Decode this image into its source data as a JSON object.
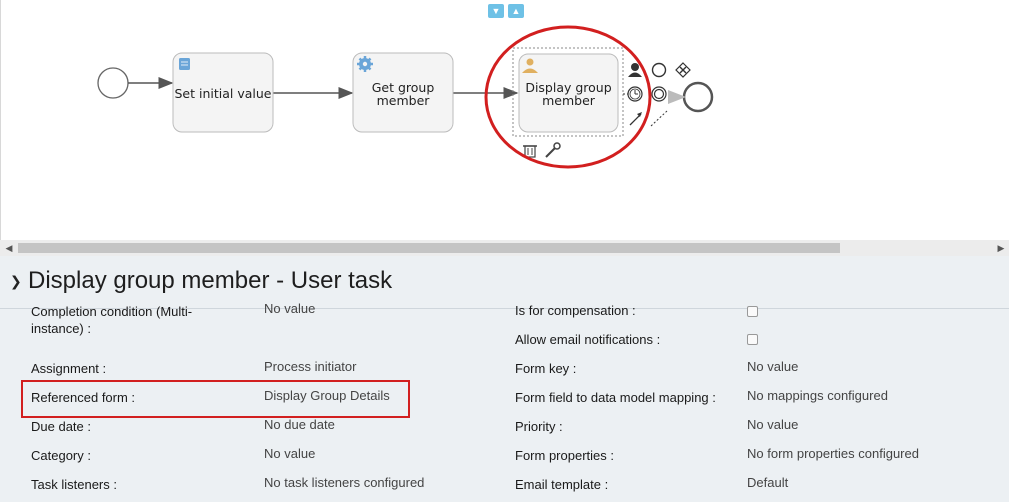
{
  "diagram": {
    "tasks": [
      {
        "label": "Set initial value",
        "icon": "script-icon"
      },
      {
        "label_line1": "Get group",
        "label_line2": "member",
        "icon": "gear-icon"
      },
      {
        "label_line1": "Display group",
        "label_line2": "member",
        "icon": "user-icon"
      }
    ],
    "highlight_color": "#d21f1f",
    "task_fill": "#f4f4f4",
    "task_stroke": "#bbbbbb"
  },
  "properties": {
    "title": "Display group member - User task",
    "left": [
      {
        "label_line1": "Completion condition (Multi-",
        "label_line2": "instance) :",
        "value": "No value"
      },
      {
        "label": "Assignment :",
        "value": "Process initiator"
      },
      {
        "label": "Referenced form :",
        "value": "Display Group Details"
      },
      {
        "label": "Due date :",
        "value": "No due date"
      },
      {
        "label": "Category :",
        "value": "No value"
      },
      {
        "label": "Task listeners :",
        "value": "No task listeners configured"
      }
    ],
    "right": [
      {
        "label": "Is for compensation :",
        "value_type": "checkbox"
      },
      {
        "label": "Allow email notifications :",
        "value_type": "checkbox"
      },
      {
        "label": "Form key :",
        "value": "No value"
      },
      {
        "label": "Form field to data model mapping :",
        "value": "No mappings configured"
      },
      {
        "label": "Priority :",
        "value": "No value"
      },
      {
        "label": "Form properties :",
        "value": "No form properties configured"
      },
      {
        "label": "Email template :",
        "value": "Default"
      }
    ]
  }
}
